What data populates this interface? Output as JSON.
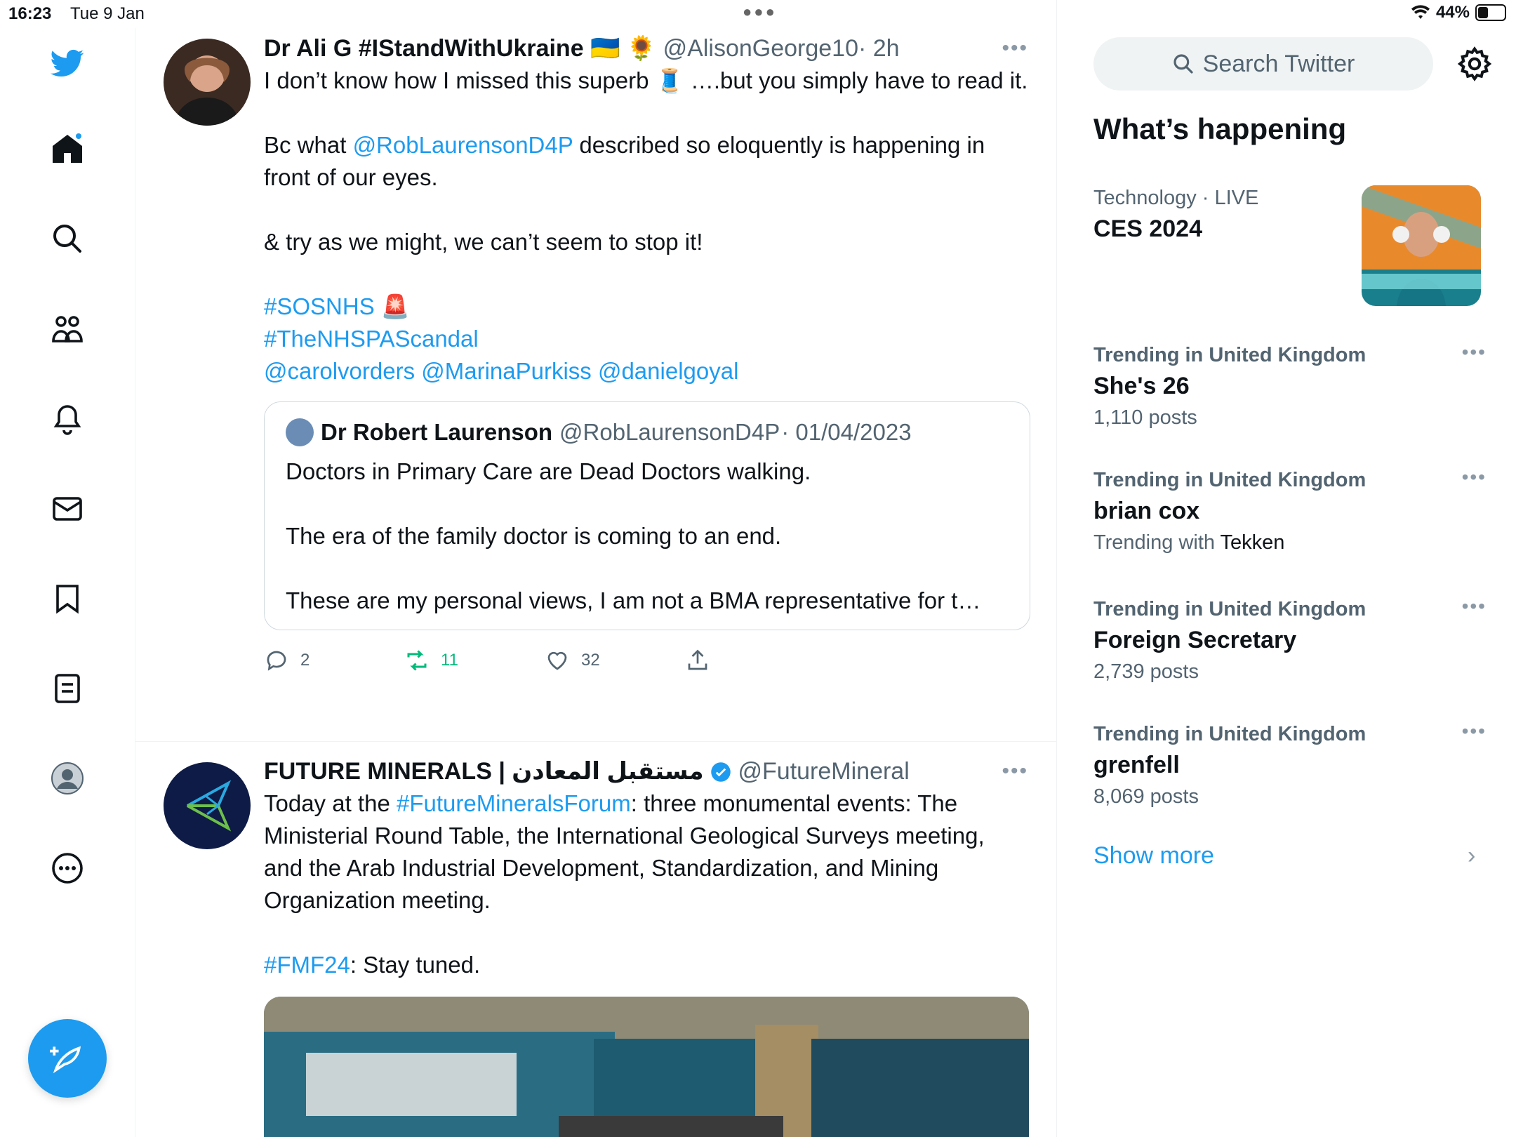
{
  "status": {
    "time": "16:23",
    "date": "Tue 9 Jan",
    "battery": "44%",
    "battery_level": 0.44
  },
  "nav": [
    {
      "icon": "twitter-logo-icon"
    },
    {
      "icon": "home-icon"
    },
    {
      "icon": "search-icon"
    },
    {
      "icon": "communities-icon"
    },
    {
      "icon": "notifications-bell-icon"
    },
    {
      "icon": "messages-envelope-icon"
    },
    {
      "icon": "bookmark-icon"
    },
    {
      "icon": "lists-icon"
    },
    {
      "icon": "profile-icon"
    },
    {
      "icon": "more-circle-icon"
    }
  ],
  "accent": "#1d9bf0",
  "tweets": [
    {
      "name": "Dr Ali G #IStandWithUkraine 🇺🇦 🌻",
      "handle": "@AlisonGeorge10",
      "time": "· 2h",
      "text_1": "I don’t know how I missed this superb 🧵 ….but you simply have to read it.",
      "text_2a": "Bc what ",
      "mention": "@RobLaurensonD4P",
      "text_2b": " described so eloquently is happening in front of our eyes.",
      "text_3": "& try as we might, we can’t seem to stop it!",
      "hashtag_1": "#SOSNHS",
      "hashtag_1_emoji": "🚨",
      "hashtag_2": "#TheNHSPAScandal",
      "mentions_line": "@carolvorders @MarinaPurkiss @danielgoyal",
      "quote": {
        "name": "Dr Robert Laurenson",
        "handle": "@RobLaurensonD4P",
        "date": "· 01/04/2023",
        "text": "Doctors in Primary Care are Dead Doctors walking.\n\nThe era of the family doctor is coming to an end.\n\nThese are my personal views, I am not a BMA representative for t…"
      },
      "replies": "2",
      "retweets": "11",
      "likes": "32"
    },
    {
      "name": "FUTURE MINERALS | مستقبل المعادن",
      "handle": "@FutureMineral",
      "text_1a": "Today at the ",
      "hashtag_1": "#FutureMineralsForum",
      "text_1b": ": three monumental events: The Ministerial Round Table, the International Geological Surveys meeting, and the Arab Industrial Development, Standardization, and Mining Organization meeting.",
      "hashtag_2": "#FMF24",
      "text_2": ": Stay tuned."
    }
  ],
  "right": {
    "search_placeholder": "Search Twitter",
    "section_title": "What’s happening",
    "featured": {
      "category": "Technology",
      "live": " · LIVE",
      "topic": "CES 2024"
    },
    "trends": [
      {
        "meta": "Trending in United Kingdom",
        "topic": "She's 26",
        "count": "1,110 posts"
      },
      {
        "meta": "Trending in United Kingdom",
        "topic": "brian cox",
        "with_prefix": "Trending with ",
        "with_value": "Tekken"
      },
      {
        "meta": "Trending in United Kingdom",
        "topic": "Foreign Secretary",
        "count": "2,739 posts"
      },
      {
        "meta": "Trending in United Kingdom",
        "topic": "grenfell",
        "count": "8,069 posts"
      }
    ],
    "show_more": "Show more"
  }
}
